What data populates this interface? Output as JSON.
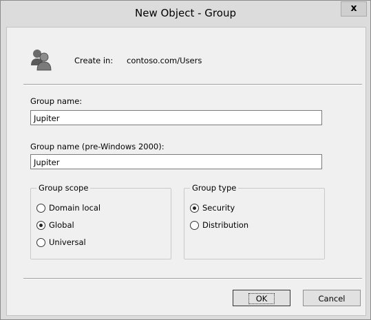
{
  "window": {
    "title": "New Object - Group",
    "close_label": "x"
  },
  "header": {
    "icon": "users-icon",
    "create_in_label": "Create in:",
    "create_in_path": "contoso.com/Users"
  },
  "form": {
    "group_name_label": "Group name:",
    "group_name_value": "Jupiter",
    "pre2000_label": "Group name (pre-Windows 2000):",
    "pre2000_value": "Jupiter"
  },
  "group_scope": {
    "legend": "Group scope",
    "options": [
      {
        "label": "Domain local",
        "checked": false
      },
      {
        "label": "Global",
        "checked": true
      },
      {
        "label": "Universal",
        "checked": false
      }
    ]
  },
  "group_type": {
    "legend": "Group type",
    "options": [
      {
        "label": "Security",
        "checked": true
      },
      {
        "label": "Distribution",
        "checked": false
      }
    ]
  },
  "buttons": {
    "ok": "OK",
    "cancel": "Cancel"
  }
}
